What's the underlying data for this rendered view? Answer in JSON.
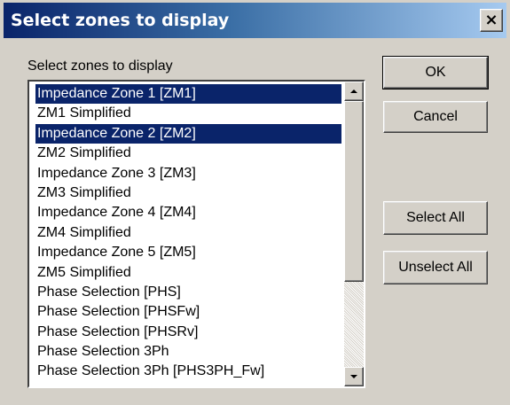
{
  "window": {
    "title": "Select zones to display",
    "close_glyph": "×"
  },
  "group_label": "Select zones to display",
  "list": {
    "items": [
      {
        "label": "Impedance Zone 1 [ZM1]",
        "selected": true
      },
      {
        "label": "ZM1 Simplified",
        "selected": false
      },
      {
        "label": "Impedance Zone 2 [ZM2]",
        "selected": true
      },
      {
        "label": "ZM2 Simplified",
        "selected": false
      },
      {
        "label": "Impedance Zone 3 [ZM3]",
        "selected": false
      },
      {
        "label": "ZM3 Simplified",
        "selected": false
      },
      {
        "label": "Impedance Zone 4 [ZM4]",
        "selected": false
      },
      {
        "label": "ZM4 Simplified",
        "selected": false
      },
      {
        "label": "Impedance Zone 5 [ZM5]",
        "selected": false
      },
      {
        "label": "ZM5 Simplified",
        "selected": false
      },
      {
        "label": "Phase Selection [PHS]",
        "selected": false
      },
      {
        "label": "Phase Selection [PHSFw]",
        "selected": false
      },
      {
        "label": "Phase Selection [PHSRv]",
        "selected": false
      },
      {
        "label": "Phase Selection 3Ph",
        "selected": false
      },
      {
        "label": "Phase Selection 3Ph [PHS3PH_Fw]",
        "selected": false
      }
    ]
  },
  "buttons": {
    "ok": "OK",
    "cancel": "Cancel",
    "select_all": "Select All",
    "unselect_all": "Unselect All"
  },
  "colors": {
    "selection": "#0a246a",
    "face": "#d4d0c8"
  }
}
